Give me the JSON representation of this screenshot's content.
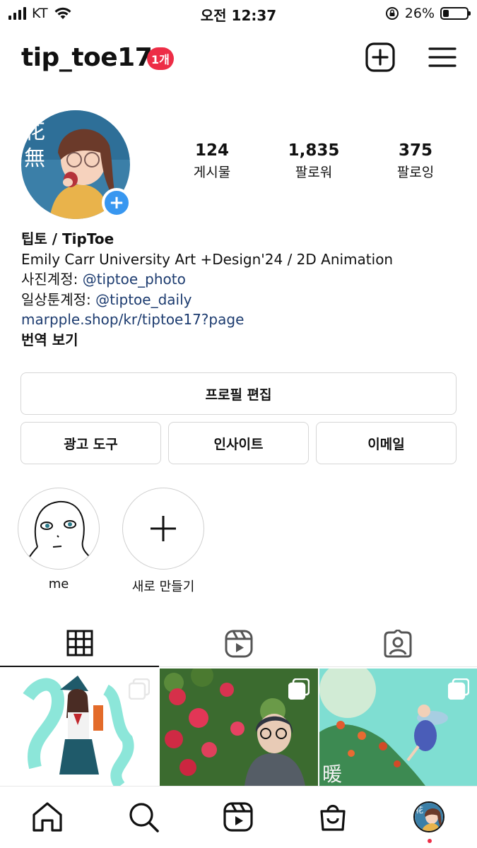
{
  "status_bar": {
    "carrier": "KT",
    "time": "오전 12:37",
    "battery_percent": "26%",
    "icons": [
      "signal-icon",
      "wifi-icon",
      "orientation-lock-icon",
      "battery-icon"
    ]
  },
  "header": {
    "username": "tip_toe17",
    "notification_badge": "1개",
    "icons": [
      "create-post-icon",
      "menu-icon"
    ]
  },
  "profile": {
    "stats": [
      {
        "value": "124",
        "label": "게시물"
      },
      {
        "value": "1,835",
        "label": "팔로워"
      },
      {
        "value": "375",
        "label": "팔로잉"
      }
    ],
    "display_name": "팁토 / TipToe",
    "bio_line1": "Emily Carr University Art +Design'24 / 2D Animation",
    "photo_account_prefix": "사진계정: ",
    "photo_account_handle": "@tiptoe_photo",
    "daily_account_prefix": "일상툰계정: ",
    "daily_account_handle": "@tiptoe_daily",
    "website": "marpple.shop/kr/tiptoe17?page",
    "translate_label": "번역 보기"
  },
  "buttons": {
    "edit_profile": "프로필 편집",
    "ad_tools": "광고 도구",
    "insights": "인사이트",
    "email": "이메일"
  },
  "highlights": [
    {
      "label": "me"
    },
    {
      "label": "새로 만들기"
    }
  ],
  "tabs": [
    "grid-icon",
    "reels-icon",
    "tagged-icon"
  ],
  "grid": {
    "posts": [
      {
        "overlay_text": ""
      },
      {
        "overlay_text": ""
      },
      {
        "overlay_text": "暖"
      }
    ]
  },
  "bottom_nav": [
    "home-icon",
    "search-icon",
    "reels-icon",
    "shop-icon",
    "profile-avatar"
  ],
  "colors": {
    "badge_red": "#ed2d46",
    "link_blue": "#1c3b6f",
    "add_story_blue": "#3897f0"
  }
}
